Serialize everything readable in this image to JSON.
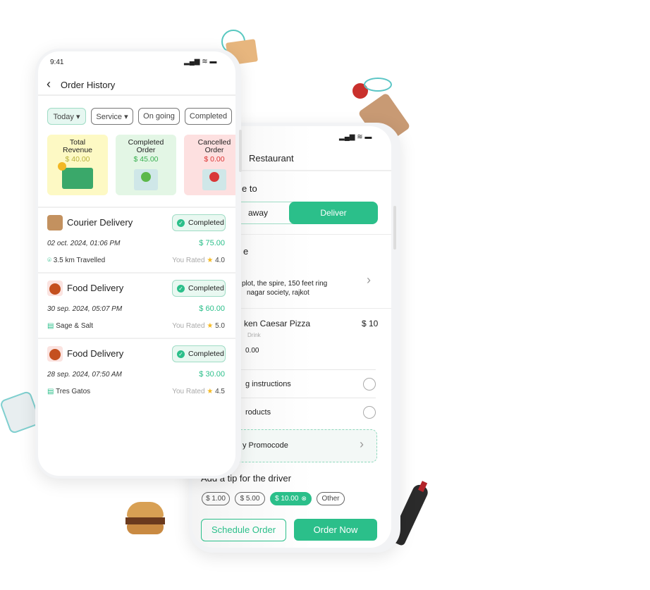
{
  "colors": {
    "accent": "#2bbf8a",
    "revenue_bg": "#fdf9c4",
    "completed_bg": "#e3f6e5",
    "cancelled_bg": "#fde0e0"
  },
  "history": {
    "status_time": "9:41",
    "title": "Order History",
    "filters": [
      {
        "label": "Today ▾",
        "active": true
      },
      {
        "label": "Service ▾"
      },
      {
        "label": "On going"
      },
      {
        "label": "Completed"
      }
    ],
    "stats": [
      {
        "label": "Total Revenue",
        "value": "$ 40.00"
      },
      {
        "label": "Completed Order",
        "value": "$ 45.00"
      },
      {
        "label": "Cancelled Order",
        "value": "$ 0.00"
      }
    ],
    "orders": [
      {
        "type": "Courier Delivery",
        "status": "Completed",
        "date": "02 oct. 2024, 01:06 PM",
        "amount": "$ 75.00",
        "meta": "3.5 km Travelled",
        "meta_icon": "location-pin-icon",
        "rated_label": "You Rated",
        "rating": "4.0"
      },
      {
        "type": "Food Delivery",
        "status": "Completed",
        "date": "30 sep. 2024, 05:07 PM",
        "amount": "$ 60.00",
        "meta": "Sage & Salt",
        "meta_icon": "store-icon",
        "rated_label": "You Rated",
        "rating": "5.0"
      },
      {
        "type": "Food Delivery",
        "status": "Completed",
        "date": "28 sep. 2024, 07:50 AM",
        "amount": "$ 30.00",
        "meta": "Tres Gatos",
        "meta_icon": "store-icon",
        "rated_label": "You Rated",
        "rating": "4.5"
      }
    ]
  },
  "checkout": {
    "title": "Restaurant",
    "section_mode": "e to",
    "mode_left": "away",
    "mode_right": "Deliver",
    "section_address": "e",
    "address_line1": "plot, the spire, 150 feet ring",
    "address_line2": "nagar society, rajkot",
    "item_name": "ken Caesar Pizza",
    "item_price": "$ 10",
    "item_sub": "Drink",
    "item_total": "0.00",
    "instructions": "g instructions",
    "products": "roducts",
    "promocode": "y Promocode",
    "tip_title": "Add a tip for the driver",
    "tips": [
      "$ 1.00",
      "$ 5.00",
      "$ 10.00",
      "Other"
    ],
    "selected_tip": "$ 10.00",
    "schedule": "Schedule Order",
    "order_now": "Order Now"
  }
}
